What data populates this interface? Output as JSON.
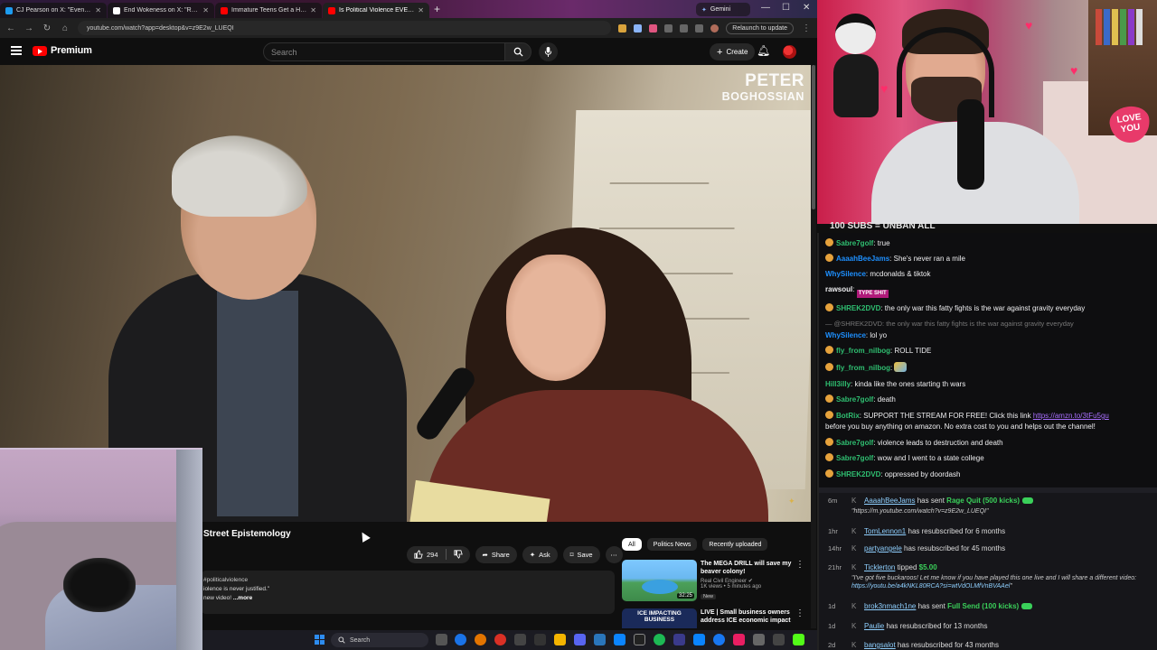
{
  "browser": {
    "tabs": [
      {
        "title": "CJ Pearson on X: \"Even CN...",
        "active": false,
        "color": "#1d9bf0"
      },
      {
        "title": "End Wokeness on X: \"Rep...",
        "active": false,
        "color": "#ffffff"
      },
      {
        "title": "Immature Teens Get a Huge Re...",
        "active": false,
        "color": "#ff0000"
      },
      {
        "title": "Is Political Violence EVER Ju...",
        "active": true,
        "color": "#ff0000"
      }
    ],
    "gemini_tab": "Gemini",
    "url": "youtube.com/watch?app=desktop&v=z9E2w_LUEQI",
    "relaunch_label": "Relaunch to update"
  },
  "youtube": {
    "logo_text": "Premium",
    "search_placeholder": "Search",
    "create_label": "Create",
    "video": {
      "watermark_line1": "PETER",
      "watermark_line2": "BOGHOSSIAN",
      "title": "Street Epistemology",
      "likes": "294",
      "share_label": "Share",
      "ask_label": "Ask",
      "save_label": "Save",
      "description": {
        "hashtag": "politicalviolence",
        "line2": "iolence is never justified.\"",
        "line3": "new video! ",
        "more": "...more"
      }
    },
    "chips": [
      "All",
      "Politics News",
      "Recently uploaded"
    ],
    "related": [
      {
        "title": "The MEGA DRILL will save my beaver colony!",
        "channel": "Real Civil Engineer",
        "meta": "1K views • 5 minutes ago",
        "badge": "New",
        "duration": "32:25"
      },
      {
        "title": "LIVE | Small business owners address ICE economic impact",
        "thumb_text": "ICE IMPACTING BUSINESS",
        "channel": "",
        "meta": "",
        "badge": "",
        "duration": ""
      }
    ]
  },
  "taskbar": {
    "search_label": "Search"
  },
  "stream": {
    "sub_goal": "100 SUBS = UNBAN ALL",
    "love_sign": "LOVE YOU"
  },
  "chat": {
    "messages": [
      {
        "user": "Sabre7golf",
        "color": "#2fbf71",
        "badge": true,
        "text": "true"
      },
      {
        "user": "AaaahBeeJams",
        "color": "#1e90ff",
        "badge": true,
        "text": "She's never ran a mile"
      },
      {
        "user": "WhySilence",
        "color": "#1e90ff",
        "badge": false,
        "text": "mcdonalds & tiktok"
      },
      {
        "user": "rawsoul",
        "color": "#efeff1",
        "badge": false,
        "text": "",
        "emote": "TYPE SHIT"
      },
      {
        "user": "SHREK2DVD",
        "color": "#2fbf71",
        "badge": true,
        "text": "the only war this fatty fights is the war against gravity everyday"
      },
      {
        "reply": "@SHREK2DVD: the only war this fatty fights is the war against gravity everyday"
      },
      {
        "user": "WhySilence",
        "color": "#1e90ff",
        "badge": false,
        "text": "lol yo"
      },
      {
        "user": "fly_from_nilbog",
        "color": "#2fbf71",
        "badge": true,
        "text": "ROLL TIDE"
      },
      {
        "user": "fly_from_nilbog",
        "color": "#2fbf71",
        "badge": true,
        "text": "",
        "emote2": true
      },
      {
        "user": "Hill3illy",
        "color": "#2fbf71",
        "badge": false,
        "text": "kinda like the ones starting th wars"
      },
      {
        "user": "Sabre7golf",
        "color": "#2fbf71",
        "badge": true,
        "text": "death"
      },
      {
        "user": "BotRix",
        "color": "#2fbf71",
        "badge": true,
        "text": "SUPPORT THE STREAM FOR FREE! Click this link ",
        "link": "https://amzn.to/3tFu5gu",
        "text2": "before you buy anything on amazon. No extra cost to you and helps out the channel!"
      },
      {
        "user": "Sabre7golf",
        "color": "#2fbf71",
        "badge": true,
        "text": "violence leads to destruction and death"
      },
      {
        "user": "Sabre7golf",
        "color": "#2fbf71",
        "badge": true,
        "text": "wow and I went to a state college"
      },
      {
        "user": "SHREK2DVD",
        "color": "#2fbf71",
        "badge": true,
        "text": "oppressed by doordash"
      }
    ]
  },
  "events": [
    {
      "ago": "6m",
      "name": "AaaahBeeJams",
      "action": " has sent ",
      "highlight": "Rage Quit (500 kicks)",
      "gift": true,
      "sub": "\"https://m.youtube.com/watch?v=z9E2w_LUEQI\""
    },
    {
      "ago": "1hr",
      "name": "TomLennon1",
      "action": " has resubscribed for 6 months",
      "highlight": "",
      "gift": false,
      "sub": ""
    },
    {
      "ago": "14hr",
      "name": "partyangele",
      "action": " has resubscribed for 45 months",
      "highlight": "",
      "gift": false,
      "sub": ""
    },
    {
      "ago": "21hr",
      "name": "Ticklerton",
      "action": " tipped ",
      "highlight": "$5.00",
      "gift": false,
      "sub": "\"I've got five buckaroos! Let me know if you have played this one live and I will share a different video:",
      "sub_link": "https://youtu.be/a4kNKL80RCA?si=wtVdOLMfVnBVAAel",
      "sub_end": "\""
    },
    {
      "ago": "1d",
      "name": "brok3nmach1ne",
      "action": " has sent ",
      "highlight": "Full Send (100 kicks)",
      "gift": true,
      "sub": ""
    },
    {
      "ago": "1d",
      "name": "Paulie",
      "action": " has resubscribed for 13 months",
      "highlight": "",
      "gift": false,
      "sub": ""
    },
    {
      "ago": "2d",
      "name": "bangsalot",
      "action": " has resubscribed for 43 months",
      "highlight": "",
      "gift": false,
      "sub": ""
    }
  ]
}
